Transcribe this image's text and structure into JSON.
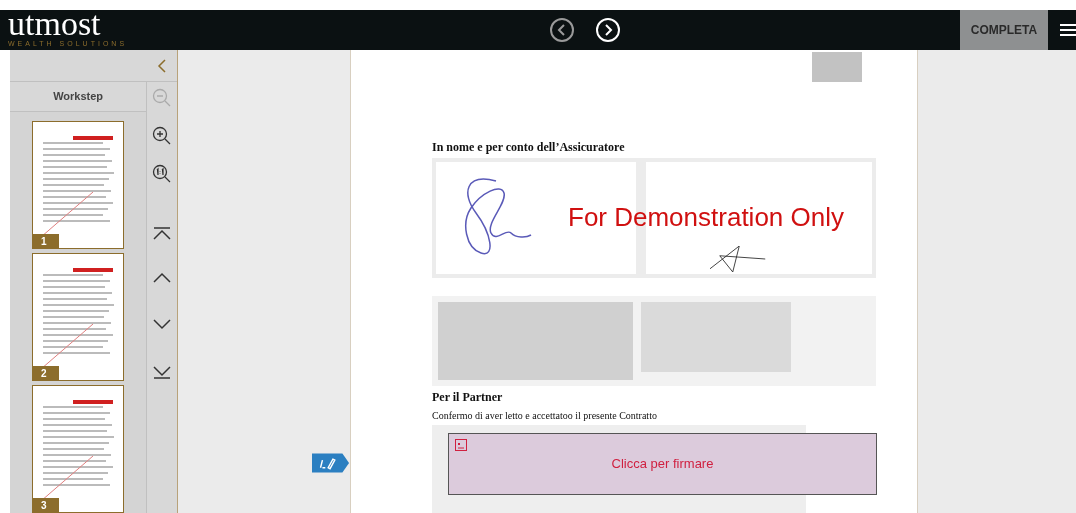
{
  "header": {
    "logo": {
      "name": "utmost",
      "tagline": "WEALTH SOLUTIONS"
    },
    "complete_button": "COMPLETA"
  },
  "sidebar": {
    "title": "Workstep",
    "thumbnails": [
      {
        "page": "1"
      },
      {
        "page": "2"
      },
      {
        "page": "3"
      }
    ]
  },
  "document": {
    "insurer_heading": "In nome e per conto dell’Assicuratore",
    "watermark": "For Demonstration Only",
    "partner_heading": "Per il Partner",
    "partner_text": "Confermo di aver letto e accettatoo il presente Contratto",
    "sign_button": "Clicca per firmare"
  }
}
